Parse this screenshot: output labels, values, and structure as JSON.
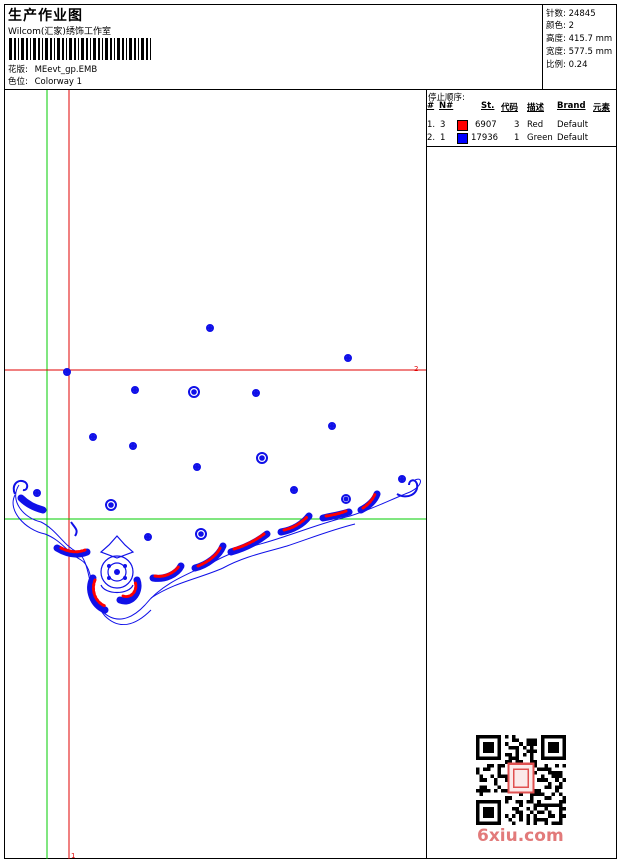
{
  "header": {
    "title": "生产作业图",
    "studio": "Wilcom(汇家)绣饰工作室",
    "design_label": "花版:",
    "design_value": "MEevt_gp.EMB",
    "colorway_label": "色位:",
    "colorway_value": "Colorway 1"
  },
  "stats": {
    "stitches": "针数: 24845",
    "colors": "颜色: 2",
    "height": "高度: 415.7 mm",
    "width": "宽度: 577.5 mm",
    "scale": "比例: 0.24"
  },
  "stop_sequence": {
    "title": "停止顺序:",
    "columns": [
      "#",
      "N#",
      "St.",
      "代码",
      "描述",
      "Brand",
      "元素"
    ],
    "rows": [
      {
        "idx": "1.",
        "n": "3",
        "st": "6907",
        "code": "3",
        "desc": "Red",
        "brand": "Default",
        "color": "#ff0000"
      },
      {
        "idx": "2.",
        "n": "1",
        "st": "17936",
        "code": "1",
        "desc": "Green",
        "brand": "Default",
        "color": "#0000ff"
      }
    ]
  },
  "canvas": {
    "guide_label_h": "2",
    "guide_label_v": "1",
    "red_color": "#e00000",
    "green_color": "#00cc00",
    "thread_blue": "#1010e8",
    "thread_red": "#ff0000"
  },
  "watermark": "6xiu.com"
}
